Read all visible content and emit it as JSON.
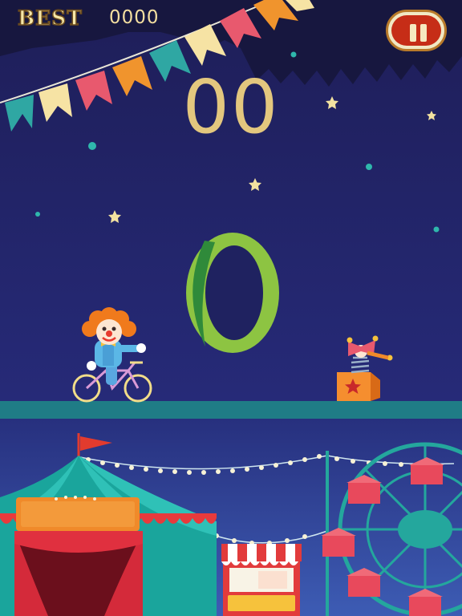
{
  "hud": {
    "best_label": "BEST",
    "best_score": "0000",
    "score": "00"
  },
  "icons": {
    "pause": "pause-icon"
  },
  "colors": {
    "sky": "#1f2260",
    "ground": "#1f7c86",
    "ring": "#8dc442",
    "pause_red": "#c62d17",
    "score_gold": "#e3c77e"
  }
}
